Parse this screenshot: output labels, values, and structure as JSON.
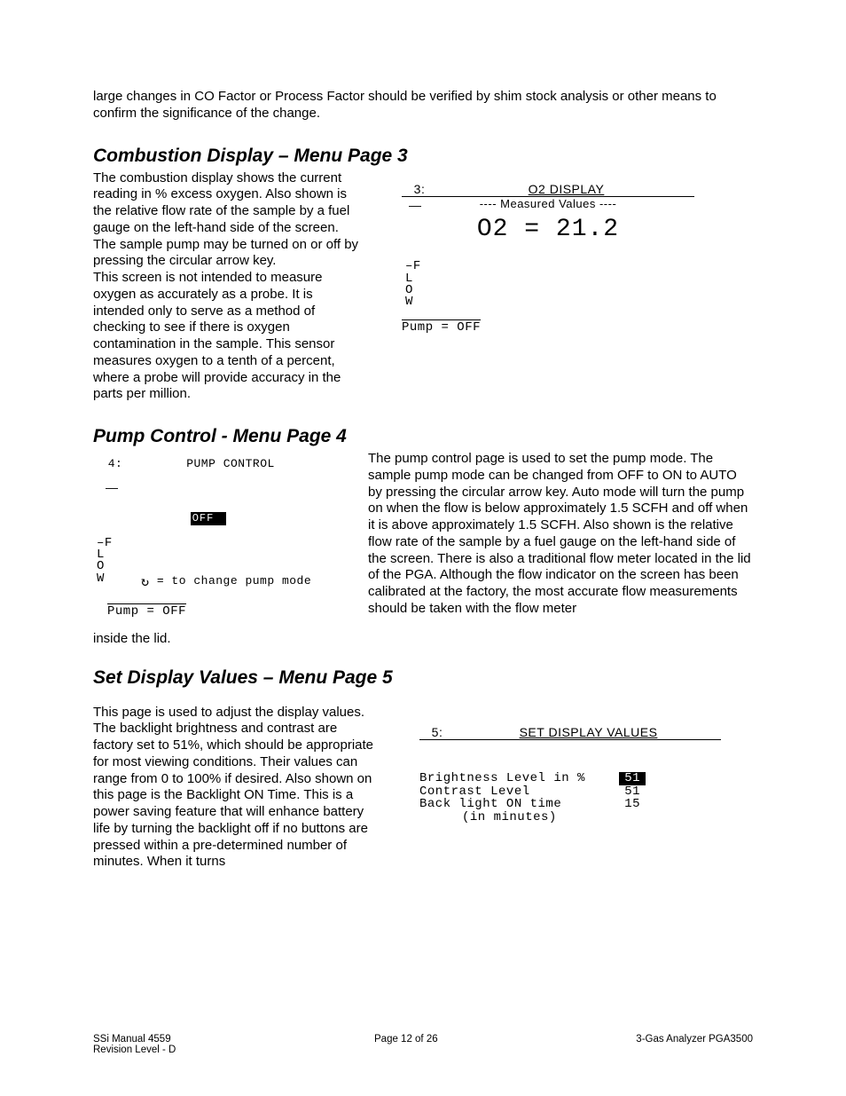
{
  "intro": "large changes in CO Factor or Process Factor should be verified by shim stock analysis or other means to confirm the significance of the change.",
  "section1": {
    "heading": "Combustion Display – Menu Page 3",
    "body": "The combustion display shows the current reading in % excess oxygen.  Also shown is the relative flow rate of the sample by a fuel gauge on the left-hand side of the screen.  The sample pump may be turned on or off by pressing the circular arrow key.\nThis screen is not intended to measure oxygen as accurately as a probe.  It is intended only to serve as a method of checking to see if there is oxygen contamination in the sample.  This sensor measures oxygen to a tenth of a percent, where a probe will provide accuracy in the parts per million.",
    "lcd": {
      "page_num": "3:",
      "title": "O2 DISPLAY",
      "subtitle": "---- Measured Values ----",
      "reading": "O2 = 21.2",
      "flow_marker_top": "–F",
      "flow_marker_l": " L",
      "flow_marker_o": " O",
      "flow_marker_w": " W",
      "pump_label": "Pump = OFF"
    }
  },
  "section2": {
    "heading": "Pump Control - Menu Page 4",
    "body": "The pump control page is used to set the pump mode. The sample pump mode can be changed from OFF to ON to AUTO by pressing the circular arrow key.  Auto mode will turn the pump on when the flow is below approximately 1.5 SCFH and off when it is above approximately 1.5 SCFH.  Also shown is the relative flow rate of the sample by a fuel gauge on the left-hand side of the screen.  There is also a traditional flow meter located in the lid of the PGA.  Although the flow indicator on the screen has been calibrated at the factory, the most accurate flow measurements should be taken with the flow meter",
    "tail": "inside the lid.",
    "lcd": {
      "page_num": "4:",
      "title": "PUMP CONTROL",
      "mode_box": "OFF",
      "flow_marker_top": "–F",
      "flow_marker_l": " L",
      "flow_marker_o": " O",
      "flow_marker_w": " W",
      "hint_symbol": "↻",
      "hint_text": " = to change pump mode",
      "pump_label": "Pump = OFF"
    }
  },
  "section3": {
    "heading": "Set Display Values – Menu Page 5",
    "body": "This page is used to adjust the display values.  The backlight brightness and contrast are factory set to 51%, which should be appropriate for most viewing conditions.  Their values can range from 0 to 100% if desired.  Also shown on this page is the Backlight ON Time.  This is a power saving feature that will enhance battery life by turning the backlight off if no buttons are pressed within a pre-determined number of minutes.  When it turns",
    "lcd": {
      "page_num": "5:",
      "title": "SET DISPLAY VALUES",
      "rows": {
        "r1_label": "Brightness Level in %",
        "r1_val": "51",
        "r2_label": "Contrast Level",
        "r2_val": "51",
        "r3_label": "Back light ON time",
        "r3_val": "15",
        "r4_label": "(in minutes)"
      }
    }
  },
  "footer": {
    "left1": "SSi Manual 4559",
    "left2": "Revision Level - D",
    "center": "Page 12 of 26",
    "right": "3-Gas Analyzer PGA3500"
  }
}
